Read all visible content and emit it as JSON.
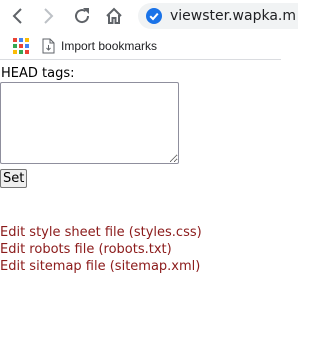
{
  "browser": {
    "url": "viewster.wapka.m",
    "bookmarks": [
      {
        "label": "Import bookmarks",
        "icon": "import-bookmarks-icon"
      }
    ],
    "icons": {
      "back": "back-arrow-icon",
      "forward": "forward-arrow-icon",
      "reload": "reload-icon",
      "home": "home-icon",
      "secure": "secure-check-icon",
      "apps": "apps-grid-icon"
    },
    "colors": {
      "secure_badge": "#1a73e8",
      "omnibox_bg": "#f1f3f4"
    }
  },
  "form": {
    "head_label": "HEAD tags:",
    "head_value": "",
    "set_button": "Set"
  },
  "links": [
    {
      "label": "Edit style sheet file (styles.css)"
    },
    {
      "label": "Edit robots file (robots.txt)"
    },
    {
      "label": "Edit sitemap file (sitemap.xml)"
    }
  ],
  "colors": {
    "link": "#8b1a1a"
  }
}
